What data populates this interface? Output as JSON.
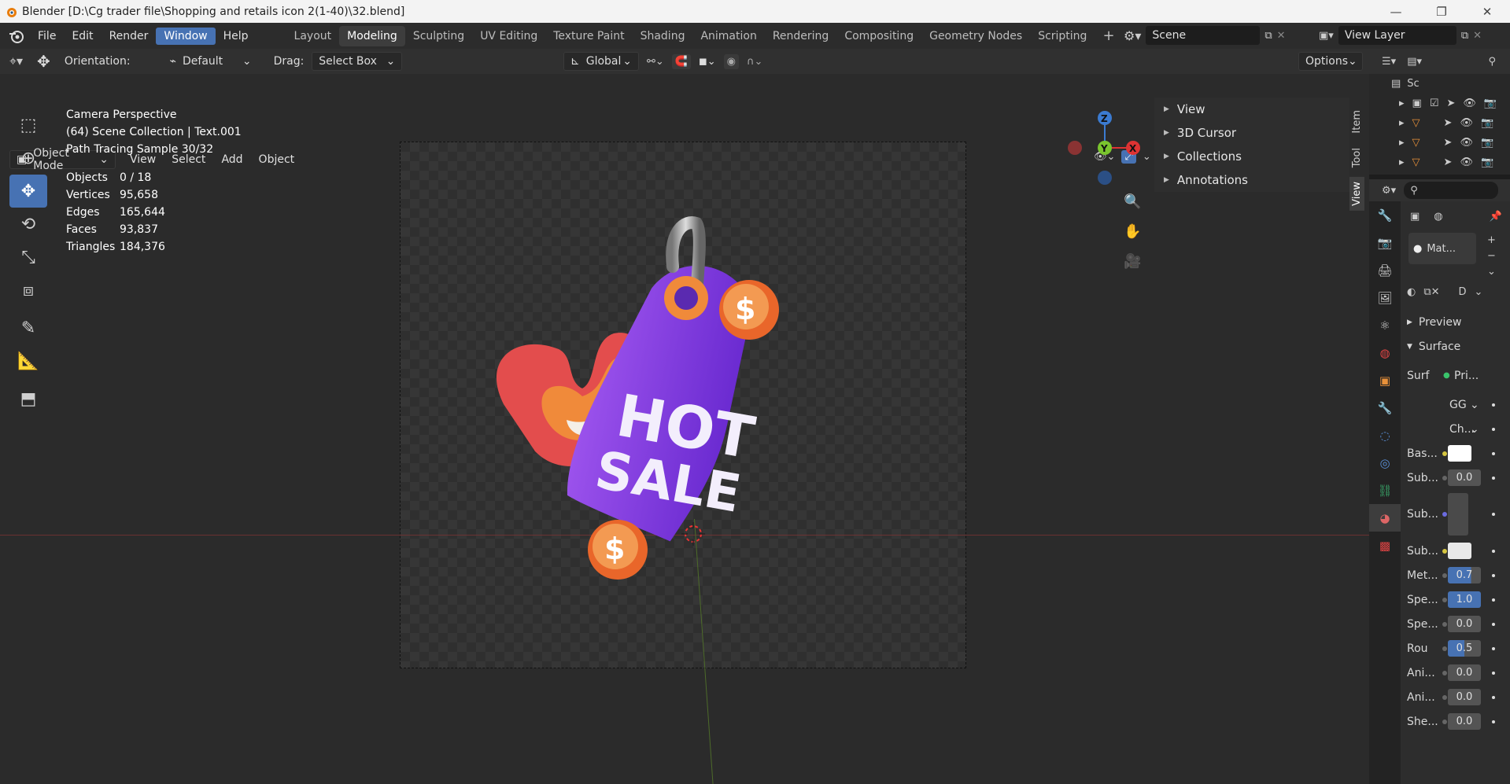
{
  "window": {
    "title": "Blender [D:\\Cg trader file\\Shopping and retails icon 2(1-40)\\32.blend]",
    "controls": {
      "minimize": "—",
      "maximize": "❐",
      "close": "✕"
    }
  },
  "menus": [
    "File",
    "Edit",
    "Render",
    "Window",
    "Help"
  ],
  "active_menu": "Window",
  "workspaces": [
    "Layout",
    "Modeling",
    "Sculpting",
    "UV Editing",
    "Texture Paint",
    "Shading",
    "Animation",
    "Rendering",
    "Compositing",
    "Geometry Nodes",
    "Scripting"
  ],
  "active_workspace": "Modeling",
  "add_workspace": "+",
  "scene_name": "Scene",
  "view_layer_name": "View Layer",
  "toolheader": {
    "orientation_label": "Orientation:",
    "orientation_value": "Default",
    "drag_label": "Drag:",
    "drag_value": "Select Box",
    "transform_space": "Global",
    "options_label": "Options"
  },
  "viewport_header": {
    "mode": "Object Mode",
    "menus": [
      "View",
      "Select",
      "Add",
      "Object"
    ]
  },
  "overlay": {
    "line1": "Camera Perspective",
    "line2": "(64) Scene Collection | Text.001",
    "line3": "Path Tracing Sample 30/32",
    "stats": [
      {
        "label": "Objects",
        "value": "0 / 18"
      },
      {
        "label": "Vertices",
        "value": "95,658"
      },
      {
        "label": "Edges",
        "value": "165,644"
      },
      {
        "label": "Faces",
        "value": "93,837"
      },
      {
        "label": "Triangles",
        "value": "184,376"
      }
    ]
  },
  "artwork": {
    "line1": "HOT",
    "line2": "SALE",
    "coin_symbol": "$"
  },
  "navigation_gizmo": {
    "z": "Z",
    "y": "Y",
    "x": "X"
  },
  "npanel": {
    "rows": [
      "View",
      "3D Cursor",
      "Collections",
      "Annotations"
    ],
    "tabs": [
      "Item",
      "Tool",
      "View"
    ],
    "active_tab": "View"
  },
  "outliner": {
    "first_label": "Sc"
  },
  "properties": {
    "material_slot": "Mat...",
    "data_label": "D",
    "sections": {
      "preview": "Preview",
      "surface": "Surface"
    },
    "surface_label": "Surf",
    "surface_value": "Pri...",
    "distribution": "GG",
    "subsurface_method": "Ch...",
    "rows": [
      {
        "label": "Bas...",
        "kind": "color",
        "color": "#ffffff"
      },
      {
        "label": "Sub...",
        "kind": "value",
        "value": "0.0"
      },
      {
        "label": "Sub...",
        "kind": "vector"
      },
      {
        "label": "Sub...",
        "kind": "color",
        "color": "#e9e9e9"
      },
      {
        "label": "Met...",
        "kind": "slider",
        "value": "0.7",
        "fraction": 0.7
      },
      {
        "label": "Spe...",
        "kind": "slider",
        "value": "1.0",
        "fraction": 1.0
      },
      {
        "label": "Spe...",
        "kind": "value",
        "value": "0.0"
      },
      {
        "label": "Rou",
        "kind": "slider",
        "value": "0.5",
        "fraction": 0.5
      },
      {
        "label": "Ani...",
        "kind": "value",
        "value": "0.0"
      },
      {
        "label": "Ani...",
        "kind": "value",
        "value": "0.0"
      },
      {
        "label": "She...",
        "kind": "value",
        "value": "0.0"
      }
    ]
  },
  "colors": {
    "accent": "#4772b3",
    "tag_purple": "#8a3fe0",
    "coin_orange": "#f07a2e",
    "flame_red": "#e24a4a"
  }
}
